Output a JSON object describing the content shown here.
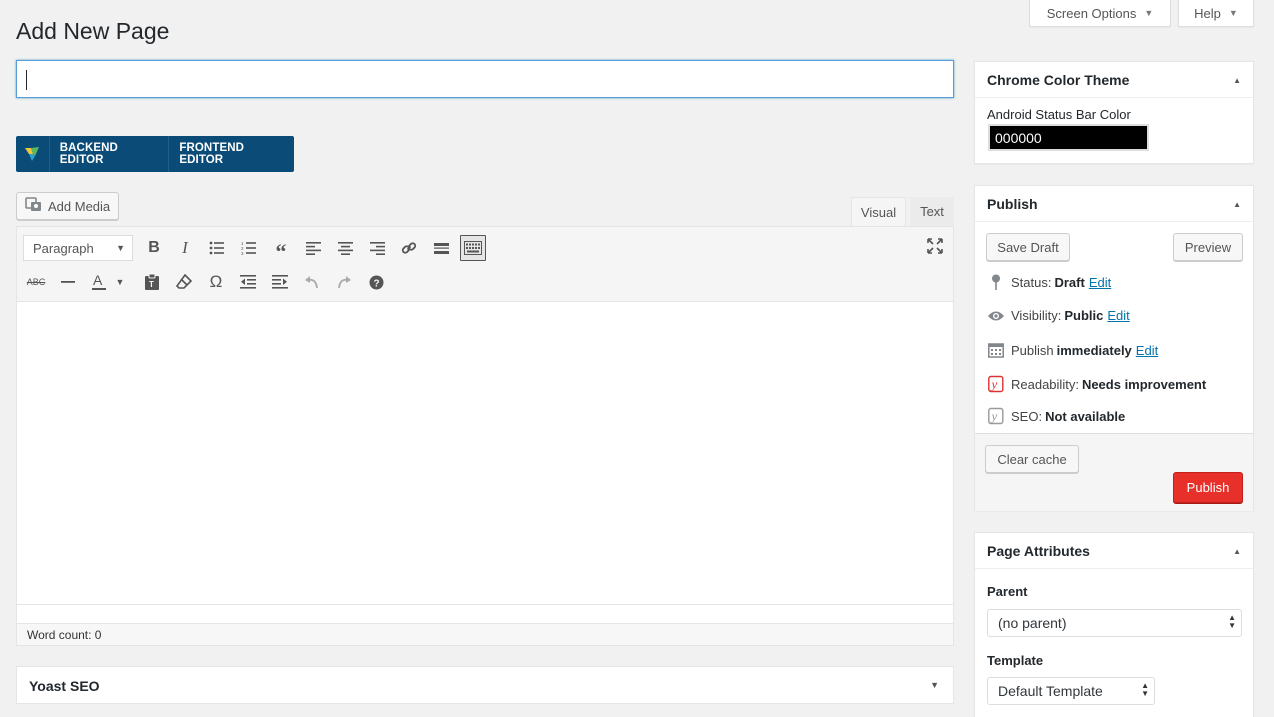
{
  "screen_meta": {
    "screen_options": "Screen Options",
    "help": "Help"
  },
  "page": {
    "title": "Add New Page",
    "title_value": ""
  },
  "vc": {
    "backend": "BACKEND EDITOR",
    "frontend": "FRONTEND EDITOR"
  },
  "editor": {
    "add_media": "Add Media",
    "tabs": {
      "visual": "Visual",
      "text": "Text"
    },
    "format": "Paragraph",
    "word_count": "Word count: 0",
    "content": ""
  },
  "yoast": {
    "title": "Yoast SEO"
  },
  "chrome_theme": {
    "title": "Chrome Color Theme",
    "label": "Android Status Bar Color",
    "value": "000000"
  },
  "publish": {
    "title": "Publish",
    "save_draft": "Save Draft",
    "preview": "Preview",
    "status_label": "Status:",
    "status_value": "Draft",
    "visibility_label": "Visibility:",
    "visibility_value": "Public",
    "publish_label": "Publish",
    "publish_value": "immediately",
    "edit": "Edit",
    "readability_label": "Readability:",
    "readability_value": "Needs improvement",
    "seo_label": "SEO:",
    "seo_value": "Not available",
    "clear_cache": "Clear cache",
    "publish_button": "Publish"
  },
  "page_attributes": {
    "title": "Page Attributes",
    "parent_label": "Parent",
    "parent_value": "(no parent)",
    "template_label": "Template",
    "template_value": "Default Template"
  },
  "colors": {
    "accent": "#0073aa",
    "publish": "#e8302b",
    "vc_bar": "#0a4b78"
  }
}
